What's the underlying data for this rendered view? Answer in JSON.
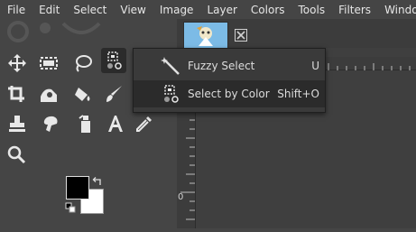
{
  "menu": [
    "File",
    "Edit",
    "Select",
    "View",
    "Image",
    "Layer",
    "Colors",
    "Tools",
    "Filters",
    "Windows"
  ],
  "popup": {
    "items": [
      {
        "label": "Fuzzy Select",
        "shortcut": "U"
      },
      {
        "label": "Select by Color",
        "shortcut": "Shift+O"
      }
    ]
  },
  "ruler": {
    "zero_label": "0"
  },
  "colors": {
    "foreground": "#000000",
    "background": "#ffffff",
    "image_tab": "#79b6e0"
  },
  "tools": [
    "move-icon",
    "rect-select-icon",
    "lasso-icon",
    "select-by-color-icon",
    "crop-icon",
    "warp-transform-icon",
    "bucket-fill-icon",
    "paintbrush-icon",
    "clone-icon",
    "smudge-icon",
    "eraser-icon",
    "text-icon",
    "color-picker-icon",
    "zoom-icon"
  ]
}
